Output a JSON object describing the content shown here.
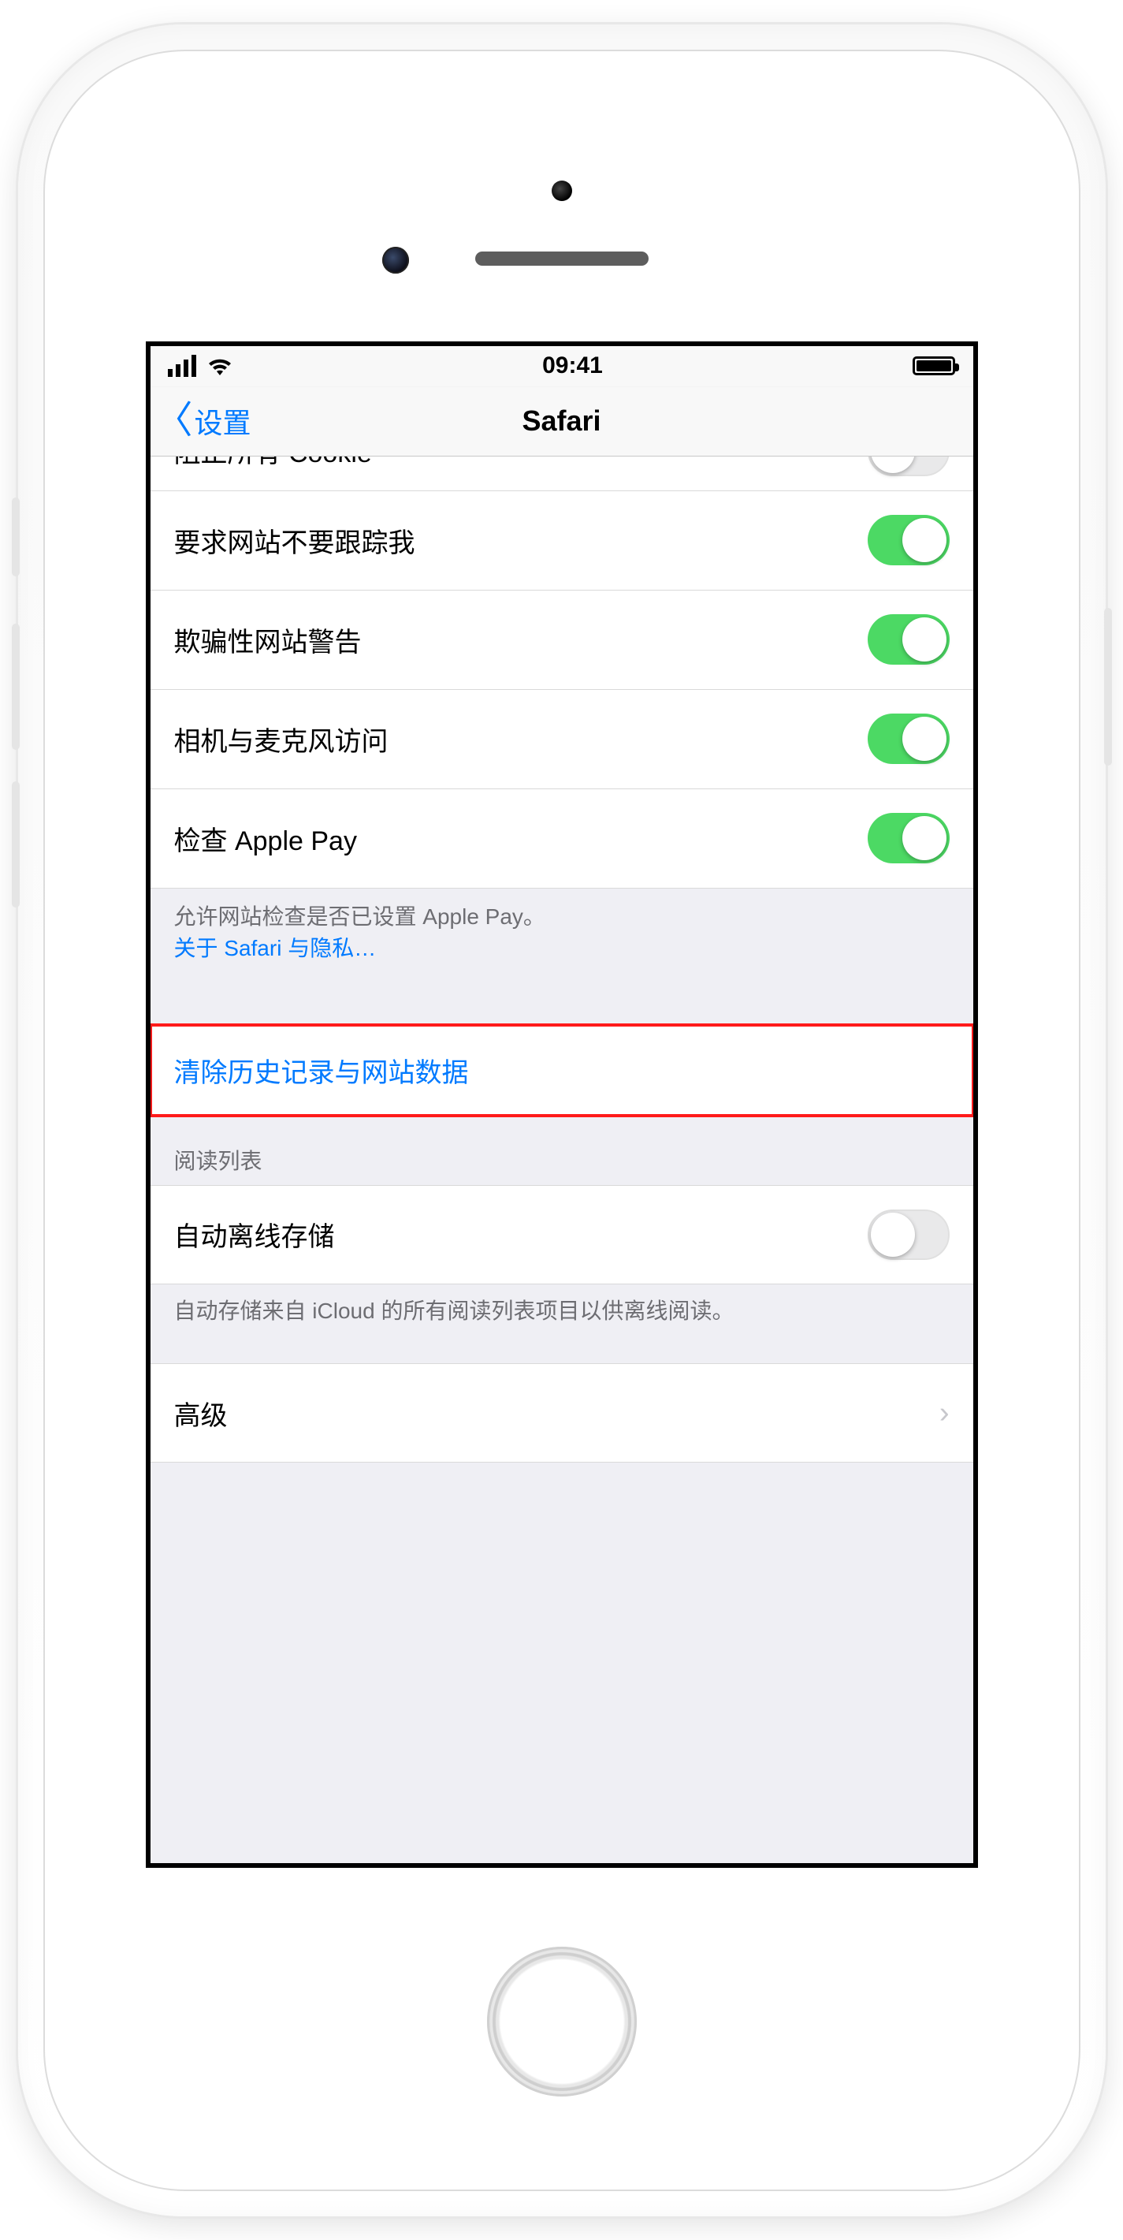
{
  "status": {
    "time": "09:41"
  },
  "nav": {
    "back_label": "设置",
    "title": "Safari"
  },
  "rows": {
    "block_cookies": {
      "label": "阻止所有 Cookie",
      "on": false
    },
    "do_not_track": {
      "label": "要求网站不要跟踪我",
      "on": true
    },
    "fraud_warning": {
      "label": "欺骗性网站警告",
      "on": true
    },
    "camera_mic": {
      "label": "相机与麦克风访问",
      "on": true
    },
    "check_apple_pay": {
      "label": "检查 Apple Pay",
      "on": true
    },
    "apple_pay_note": "允许网站检查是否已设置 Apple Pay。",
    "privacy_link": "关于 Safari 与隐私…",
    "clear_button": "清除历史记录与网站数据",
    "reading_list_header": "阅读列表",
    "auto_offline": {
      "label": "自动离线存储",
      "on": false
    },
    "auto_offline_note": "自动存储来自 iCloud 的所有阅读列表项目以供离线阅读。",
    "advanced": {
      "label": "高级"
    }
  }
}
